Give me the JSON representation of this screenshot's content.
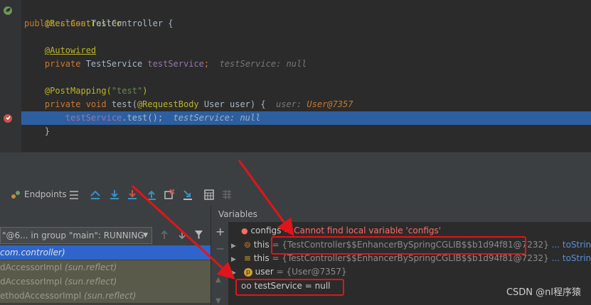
{
  "editor": {
    "lines": {
      "l1_ann": "@RestController",
      "l2_kw": "public class ",
      "l2_name": "TestController {",
      "l4_ann": "@Autowired",
      "l5_kw": "private ",
      "l5_type": "TestService ",
      "l5_field": "testService",
      "l5_semi": ";",
      "l5_hint": "testService: null",
      "l7_ann": "@PostMapping(",
      "l7_str": "\"test\"",
      "l7_close": ")",
      "l8_kw": "private void ",
      "l8_sig1": "test(",
      "l8_ann": "@RequestBody",
      "l8_sig2": " User user) {",
      "l8_hint_label": "user: ",
      "l8_hint_val": "User@7357",
      "l9_field": "testService",
      "l9_call": ".test();",
      "l9_hint": "testService: null",
      "l10_brace": "}"
    }
  },
  "toolbar": {
    "endpoints_label": "Endpoints"
  },
  "frames": {
    "thread_select_value": "\"@6... in group \"main\": RUNNING",
    "rows": [
      {
        "text": "com.controller)",
        "pkg": ""
      },
      {
        "text": "dAccessorImpl ",
        "pkg": "(sun.reflect)"
      },
      {
        "text": "dAccessorImpl ",
        "pkg": "(sun.reflect)"
      },
      {
        "text": "ethodAccessorImpl ",
        "pkg": "(sun.reflect)"
      }
    ]
  },
  "variables": {
    "title": "Variables",
    "configs_name": "configs",
    "configs_value": " = Cannot find local variable 'configs'",
    "this1_name": "this",
    "this1_value": " = {TestController$$EnhancerBySpringCGLIB$$b1d94f81@7232}",
    "this1_link": " ... toString()",
    "this2_name": "this",
    "this2_value": " = {TestController$$EnhancerBySpringCGLIB$$b1d94f81@7232}",
    "this2_link": " ... toString()",
    "user_name": "user",
    "user_value": " = {User@7357}",
    "testService_name": "testService",
    "testService_value": " = null"
  },
  "watermark": "CSDN @nl程序猿",
  "colors": {
    "highlight": "#2d5fa0",
    "annotation_red": "#e0151b",
    "selected_frame": "#2f65ca"
  }
}
